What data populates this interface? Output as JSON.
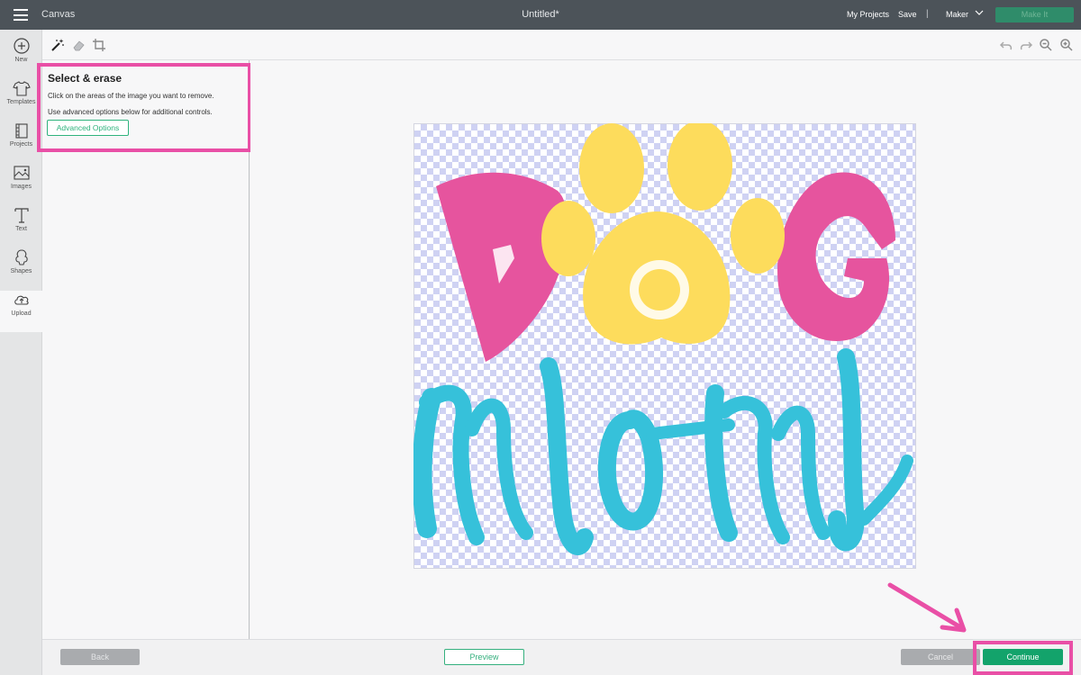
{
  "topbar": {
    "app_name": "Canvas",
    "doc_title": "Untitled*",
    "my_projects": "My Projects",
    "save": "Save",
    "separator": "|",
    "machine": "Maker",
    "make_it": "Make It"
  },
  "leftnav": {
    "items": [
      {
        "label": "New",
        "icon": "plus-circle-icon"
      },
      {
        "label": "Templates",
        "icon": "tshirt-icon"
      },
      {
        "label": "Projects",
        "icon": "projects-icon"
      },
      {
        "label": "Images",
        "icon": "image-icon"
      },
      {
        "label": "Text",
        "icon": "text-icon"
      },
      {
        "label": "Shapes",
        "icon": "shapes-icon"
      },
      {
        "label": "Upload",
        "icon": "cloud-upload-icon"
      }
    ]
  },
  "tools": [
    "magic-wand-icon",
    "eraser-icon",
    "crop-icon",
    "undo-icon",
    "redo-icon",
    "zoom-out-icon",
    "zoom-in-icon"
  ],
  "panel": {
    "title": "Select & erase",
    "line1": "Click on the areas of the image you want to remove.",
    "line2": "Use advanced options below for additional controls.",
    "advanced_button": "Advanced Options"
  },
  "bottom": {
    "back": "Back",
    "preview": "Preview",
    "cancel": "Cancel",
    "continue": "Continue"
  },
  "colors": {
    "accent_green": "#13a36b",
    "highlight_pink": "#e94fa6",
    "art_pink": "#e6549e",
    "art_yellow": "#fddc5c",
    "art_cyan": "#36c1da"
  }
}
